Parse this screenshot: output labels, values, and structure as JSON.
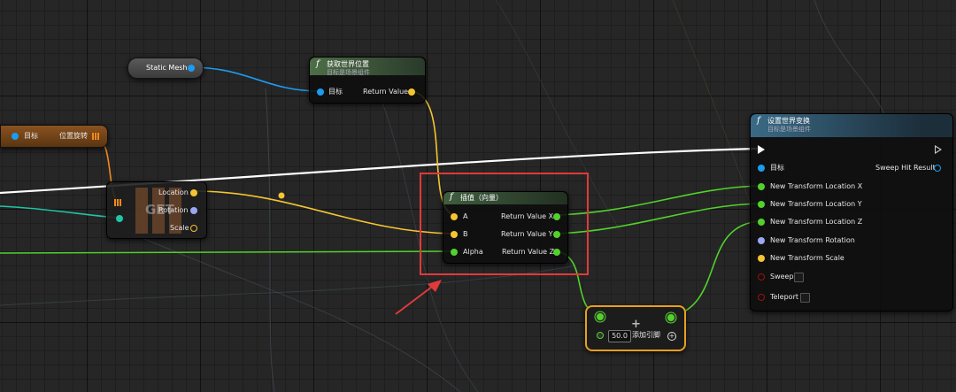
{
  "nodes": {
    "static_mesh": {
      "label": "Static Mesh"
    },
    "get_world_location": {
      "title": "获取世界位置",
      "subtitle": "目标是场景组件",
      "target": "目标",
      "return_value": "Return Value"
    },
    "break_rotator": {
      "target": "目标",
      "output": "位置旋转"
    },
    "break_transform": {
      "watermark": "GET",
      "location": "Location",
      "rotation": "Rotation",
      "scale": "Scale"
    },
    "lerp_vector": {
      "title": "插值（向量）",
      "a": "A",
      "b": "B",
      "alpha": "Alpha",
      "rx": "Return Value X",
      "ry": "Return Value Y",
      "rz": "Return Value Z"
    },
    "add_node": {
      "value": "50.0",
      "add_pin": "添加引脚",
      "plus": "+"
    },
    "set_world_transform": {
      "title": "设置世界变换",
      "subtitle": "目标是场景组件",
      "target": "目标",
      "sweep_hit": "Sweep Hit Result",
      "loc_x": "New Transform Location X",
      "loc_y": "New Transform Location Y",
      "loc_z": "New Transform Location Z",
      "rotation": "New Transform Rotation",
      "scale": "New Transform Scale",
      "sweep": "Sweep",
      "teleport": "Teleport"
    }
  },
  "function_glyph": "f",
  "colors": {
    "object_pin": "#1c9bf0",
    "vector_pin": "#f4c531",
    "float_pin": "#52d12c",
    "rotator_pin": "#9aa8f2",
    "bool_pin": "#9b1010",
    "exec_wire": "#ffffff",
    "struct_pin": "#f08a1c",
    "teal_wire": "#21c4a4",
    "highlight": "#e03a3a",
    "function_header": "#3f5e3f",
    "set_header": "#2c4a5e",
    "rotator_header": "#7a4a1e"
  }
}
